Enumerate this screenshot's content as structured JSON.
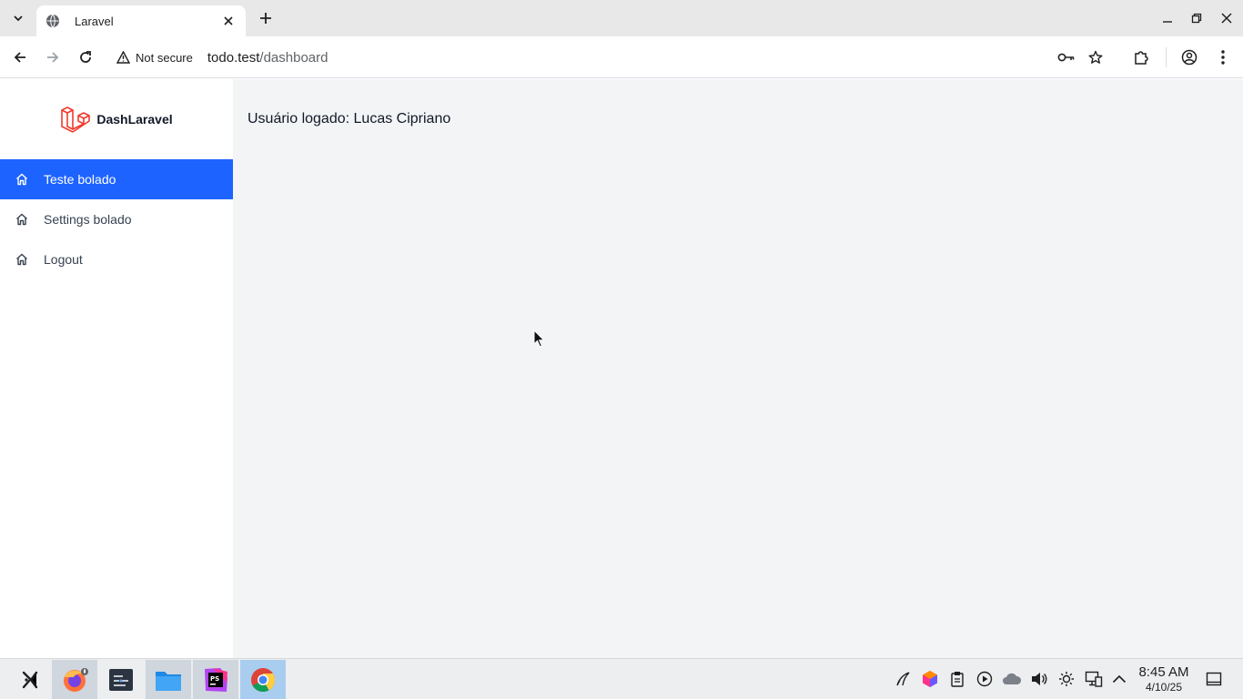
{
  "browser": {
    "tab_title": "Laravel",
    "security_label": "Not secure",
    "url_host": "todo.test",
    "url_path": "/dashboard"
  },
  "sidebar": {
    "brand": "DashLaravel",
    "items": [
      {
        "label": "Teste bolado",
        "icon": "home-icon",
        "active": true
      },
      {
        "label": "Settings bolado",
        "icon": "home-icon",
        "active": false
      },
      {
        "label": "Logout",
        "icon": "home-icon",
        "active": false
      }
    ]
  },
  "main": {
    "logged_user_text": "Usuário logado: Lucas Cipriano"
  },
  "taskbar": {
    "apps": [
      "launcher-icon",
      "firefox-icon",
      "terminal-icon",
      "files-icon",
      "phpstorm-icon",
      "chrome-icon"
    ],
    "time": "8:45 AM",
    "date": "4/10/25"
  },
  "colors": {
    "accent": "#1d63ff",
    "page_bg": "#f3f4f6",
    "laravel_red": "#ef3b2d"
  }
}
